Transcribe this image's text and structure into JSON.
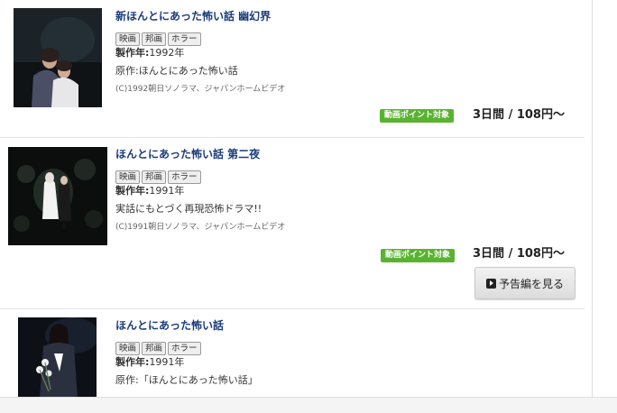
{
  "items": [
    {
      "title": "新ほんとにあった怖い話 幽幻界",
      "tags": [
        "映画",
        "邦画",
        "ホラー"
      ],
      "year_label": "製作年:",
      "year": "1992年",
      "desc": "原作:ほんとにあった怖い話",
      "copyright": "(C)1992朝日ソノラマ、ジャパンホームビデオ",
      "badge": "動画ポイント対象",
      "price": "3日間 / 108円～"
    },
    {
      "title": "ほんとにあった怖い話 第二夜",
      "tags": [
        "映画",
        "邦画",
        "ホラー"
      ],
      "year_label": "製作年:",
      "year": "1991年",
      "desc": "実話にもとづく再現恐怖ドラマ!!",
      "copyright": "(C)1991朝日ソノラマ、ジャパンホームビデオ",
      "badge": "動画ポイント対象",
      "price": "3日間 / 108円～",
      "trailer_label": "予告編を見る"
    },
    {
      "title": "ほんとにあった怖い話",
      "tags": [
        "映画",
        "邦画",
        "ホラー"
      ],
      "year_label": "製作年:",
      "year": "1991年",
      "desc": "原作:「ほんとにあった怖い話」"
    }
  ],
  "colors": {
    "title": "#1c3d7a",
    "badge": "#5ab330",
    "separator": "#e3e3e3"
  }
}
